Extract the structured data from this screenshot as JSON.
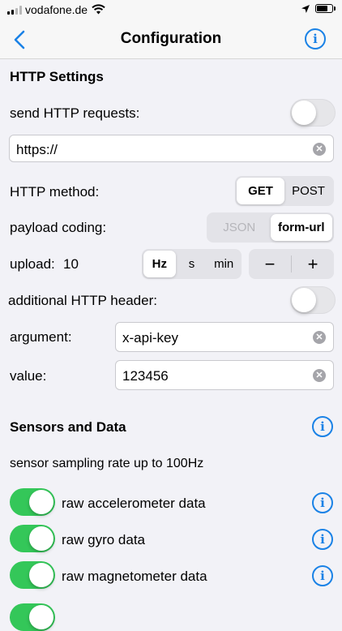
{
  "status_bar": {
    "carrier": "vodafone.de"
  },
  "nav": {
    "title": "Configuration",
    "back_icon": "chevron-left",
    "info_icon": "info-circle"
  },
  "http": {
    "section_title": "HTTP Settings",
    "send_label": "send HTTP requests:",
    "send_on": false,
    "url_value": "https://",
    "method_label": "HTTP method:",
    "method_options": [
      "GET",
      "POST"
    ],
    "method_selected": "GET",
    "coding_label": "payload coding:",
    "coding_options": [
      "JSON",
      "form-url"
    ],
    "coding_selected": "form-url",
    "upload_label": "upload:",
    "upload_value": "10",
    "upload_units": [
      "Hz",
      "s",
      "min"
    ],
    "upload_unit_selected": "Hz",
    "stepper_minus": "−",
    "stepper_plus": "+",
    "header_label": "additional HTTP header:",
    "header_on": false,
    "argument_label": "argument:",
    "argument_value": "x-api-key",
    "value_label": "value:",
    "value_value": "123456"
  },
  "sensors": {
    "section_title": "Sensors and Data",
    "rate_text": "sensor sampling rate up to 100Hz",
    "items": [
      {
        "label": "raw accelerometer data",
        "on": true
      },
      {
        "label": "raw gyro data",
        "on": true
      },
      {
        "label": "raw magnetometer data",
        "on": true
      }
    ]
  },
  "colors": {
    "accent": "#1a82e6",
    "toggle_on": "#34c759",
    "background": "#f2f2f7"
  }
}
